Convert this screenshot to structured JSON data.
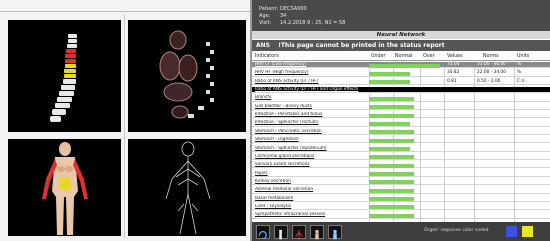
{
  "patient": {
    "rows": [
      {
        "label": "Patient:",
        "value": "DECSA000"
      },
      {
        "label": "Age:",
        "value": "34"
      },
      {
        "label": "Visit:",
        "value": "14.2.2018  9 : 25, N1 = 58"
      }
    ]
  },
  "panel_title": "Neural Network",
  "ans": {
    "code": "ANS",
    "message": "!This page cannot be printed in the status report"
  },
  "table": {
    "headers": {
      "indicators": "Indicators",
      "under": "Under",
      "normal": "Normal",
      "over": "Over",
      "values": "Values",
      "norms": "Norms",
      "units": "Units"
    },
    "rows": [
      {
        "label": "HRV LF (Low frequency)",
        "level": 0.95,
        "value": "73.04",
        "norm": "33.00 - 46.00",
        "unit": "%",
        "style": "sel"
      },
      {
        "label": "HRV HF (High frequency)",
        "level": 0.55,
        "value": "30.82",
        "norm": "22.00 - 34.00",
        "unit": "%",
        "style": ""
      },
      {
        "label": "Ratio of ANS activity (LF / HF)",
        "level": 0.55,
        "value": "0.81",
        "norm": "0.50 - 2.00",
        "unit": "C.U",
        "style": ""
      },
      {
        "label": "Ratio of ANS activity (LF / HF) and Organ effects",
        "level": 0,
        "value": "",
        "norm": "",
        "unit": "",
        "style": "black"
      },
      {
        "label": "Bronchi",
        "level": 0.6,
        "value": "",
        "norm": "",
        "unit": "",
        "style": ""
      },
      {
        "label": "Gall bladder - Biliary ducts",
        "level": 0.6,
        "value": "",
        "norm": "",
        "unit": "",
        "style": ""
      },
      {
        "label": "Intestine - Peristalsis and tonus",
        "level": 0.6,
        "value": "",
        "norm": "",
        "unit": "",
        "style": ""
      },
      {
        "label": "Intestine - Sphincter (rectum)",
        "level": 0.55,
        "value": "",
        "norm": "",
        "unit": "",
        "style": ""
      },
      {
        "label": "Stomach - Pancreatic secretion",
        "level": 0.6,
        "value": "",
        "norm": "",
        "unit": "",
        "style": ""
      },
      {
        "label": "Stomach - Digestion",
        "level": 0.6,
        "value": "",
        "norm": "",
        "unit": "",
        "style": ""
      },
      {
        "label": "Stomach - Sphincter (duodenum)",
        "level": 0.55,
        "value": "",
        "norm": "",
        "unit": "",
        "style": ""
      },
      {
        "label": "Lachrymal gland secretions",
        "level": 0.6,
        "value": "",
        "norm": "",
        "unit": "",
        "style": ""
      },
      {
        "label": "Salivary Gland secretions",
        "level": 0.6,
        "value": "",
        "norm": "",
        "unit": "",
        "style": ""
      },
      {
        "label": "Pupils",
        "level": 0.6,
        "value": "",
        "norm": "",
        "unit": "",
        "style": ""
      },
      {
        "label": "Kidney secretion",
        "level": 0.6,
        "value": "",
        "norm": "",
        "unit": "",
        "style": ""
      },
      {
        "label": "Adrenal medullar secretion",
        "level": 0.6,
        "value": "",
        "norm": "",
        "unit": "",
        "style": ""
      },
      {
        "label": "Basal metabolism",
        "level": 0.6,
        "value": "",
        "norm": "",
        "unit": "",
        "style": ""
      },
      {
        "label": "Liver - Glycolysis",
        "level": 0.6,
        "value": "",
        "norm": "",
        "unit": "",
        "style": ""
      },
      {
        "label": "Sympathetic intracranial vessels",
        "level": 0.6,
        "value": "",
        "norm": "",
        "unit": "",
        "style": ""
      }
    ]
  },
  "footer": {
    "legend": "Organ' response color coded"
  },
  "colors": {
    "bar": "#7fd35a",
    "swatch_blue": "#3f4fe0",
    "swatch_yellow": "#e8e82a"
  },
  "icons": [
    "rotate-icon",
    "spine-icon",
    "nerve-icon",
    "body-icon",
    "organs-icon"
  ]
}
